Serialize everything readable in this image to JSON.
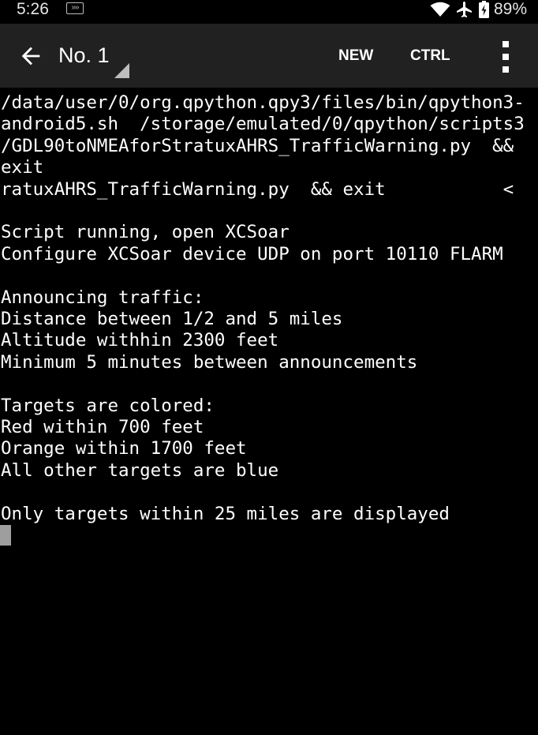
{
  "status_bar": {
    "time": "5:26",
    "notification_icon": "cast-notification-icon",
    "icons": [
      "wifi-icon",
      "airplane-mode-icon",
      "battery-charging-icon"
    ],
    "battery_percent": "89%"
  },
  "toolbar": {
    "back_icon": "arrow-left-icon",
    "title": "No. 1",
    "new_label": "NEW",
    "ctrl_label": "CTRL",
    "overflow_icon": "more-vertical-icon"
  },
  "terminal": {
    "lines": [
      "/data/user/0/org.qpython.qpy3/files/bin/qpython3-",
      "android5.sh  /storage/emulated/0/qpython/scripts3",
      "/GDL90toNMEAforStratuxAHRS_TrafficWarning.py  &&",
      "exit",
      "ratuxAHRS_TrafficWarning.py  && exit           <",
      "",
      "Script running, open XCSoar",
      "Configure XCSoar device UDP on port 10110 FLARM",
      "",
      "Announcing traffic:",
      "Distance between 1/2 and 5 miles",
      "Altitude withhin 2300 feet",
      "Minimum 5 minutes between announcements",
      "",
      "Targets are colored:",
      "Red within 700 feet",
      "Orange within 1700 feet",
      "All other targets are blue",
      "",
      "Only targets within 25 miles are displayed"
    ]
  },
  "colors": {
    "terminal_background": "#000000",
    "terminal_text": "#ffffff",
    "toolbar_background": "#212121",
    "cursor": "#9e9e9e"
  }
}
